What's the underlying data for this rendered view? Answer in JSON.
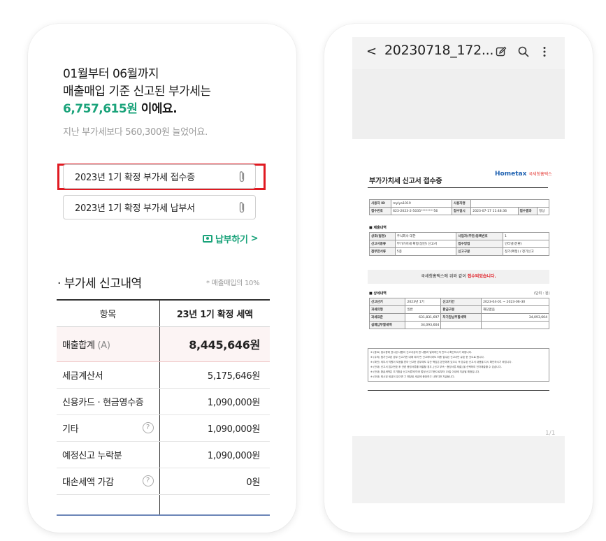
{
  "left": {
    "summary": {
      "line1": "01월부터 06월까지",
      "line2": "매출매입 기준 신고된 부가세는",
      "amount": "6,757,615원",
      "amount_suffix": " 이에요.",
      "sub": "지난 부가세보다 560,300원 늘었어요."
    },
    "receipts": [
      {
        "label": "2023년 1기 확정 부가세 접수증"
      },
      {
        "label": "2023년 1기 확정 부가세 납부서"
      }
    ],
    "pay_label": "납부하기",
    "pay_chevron": ">",
    "section_title": "· 부가세 신고내역",
    "section_note": "* 매출매입의 10%",
    "table": {
      "headers": [
        "항목",
        "23년 1기 확정 세액"
      ],
      "total": {
        "label": "매출합계",
        "unit": " (A)",
        "value": "8,445,646원"
      },
      "rows": [
        {
          "label": "세금계산서",
          "value": "5,175,646원"
        },
        {
          "label": "신용카드 · 현금영수증",
          "value": "1,090,000원"
        },
        {
          "label": "기타",
          "value": "1,090,000원",
          "help": "?"
        },
        {
          "label": "예정신고 누락분",
          "value": "1,090,000원"
        },
        {
          "label": "대손세액 가감",
          "value": "0원",
          "help": "?"
        }
      ]
    }
  },
  "right": {
    "viewer": {
      "back": "<",
      "title": "20230718_172...",
      "page_indicator": "1/1"
    },
    "doc": {
      "title": "부가가치세 신고서 접수증",
      "logo": "Hometax",
      "logo_sub": "국세청홈택스",
      "table1": [
        [
          "사용자 ID",
          "mylya1019",
          "사용자명",
          "",
          "",
          ""
        ],
        [
          "접수번호",
          "623-2023-2-5035********56",
          "접수일시",
          "2023-07-17 11:48:36",
          "접수결과",
          "정상"
        ]
      ],
      "section1": "■ 제출내역",
      "table2": [
        [
          "상호(법명)",
          "주식회사 대한",
          "사업자(주민)등록번호",
          "1"
        ],
        [
          "신고서종류",
          "부가가치세 확정(일반) 신고서",
          "접수방법",
          "인터넷(전환)"
        ],
        [
          "첨부한서류",
          "5종",
          "신고구분",
          "정기(확정) / 정기신고"
        ]
      ],
      "notice_prefix": "국세청홈택스에 위와 같이 ",
      "notice_red": "접수되었습니다.",
      "section2": "■ 상세내역",
      "unit": "(단위 : 원)",
      "table3": [
        [
          "신고년기",
          "2023년 1기",
          "신고기간",
          "2023-04-01 ~ 2023-06-30"
        ],
        [
          "과세유형",
          "일반",
          "환급구분",
          "해당없음"
        ],
        [
          "과세표준",
          "631,831,697",
          "차가감납부할세액",
          "34,093,604"
        ],
        [
          "실제납부할세액",
          "34,093,604",
          "",
          ""
        ]
      ],
      "footnotes": [
        "※ (중요) 접수증에 표시된 내용이 신고서상의 한 내용과 일치하는지 반드시 확인하시기 바랍니다.",
        "※ (주의) 첨가신고된 경우 신고기한 내에 여러 번 신고하더라도 최종 접수된 신고서만 유효 한 것으로 봅니다.",
        "※ (확인) 세무서 직원이 도움을 받아 신고한 경우에도 유관 책임은 본인에게 있으니 꼭 접수된 신고서 내용을 다시 확인하시기 바랍니다.",
        "※ (안내) 신고서 접수번호 후 관련 증빙서류를 제출할 경우, [신고 부속 · 증빙서류 제출] 을 선택하여 전자제출할 수 있습니다.",
        "※ (안내) 환급세액은 조기환급 신고서류에 따라 법정 신고기한으로부터 15일 이내에 지급될 예정입니다.",
        "※ (안내) 제시된 세금이 있으면 그 해당된 세금에 충당하고 나머지만 지급됩니다."
      ]
    }
  }
}
